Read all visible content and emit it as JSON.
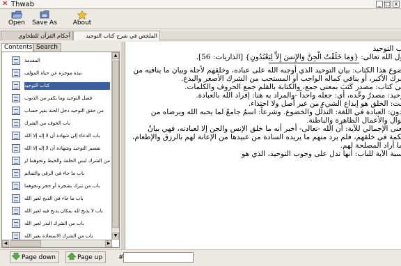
{
  "window": {
    "title": "Thwab",
    "controls": [
      "_",
      "□",
      "x"
    ]
  },
  "toolbar": {
    "open_label": "Open",
    "saveas_label": "Save As",
    "about_label": "About"
  },
  "top_tabs": [
    {
      "label": "أحكام القرآن للطحاوي"
    },
    {
      "label": "الملخص في شرح كتاب التوحيد"
    }
  ],
  "side_tabs": [
    {
      "label": "Contents"
    },
    {
      "label": "Search"
    }
  ],
  "contents": [
    {
      "label": "المقدمة"
    },
    {
      "label": "نبذة موجزة عن حياة المؤلف"
    },
    {
      "label": "كتاب التوحيد"
    },
    {
      "label": "فضل التوحيد وما يكفر من الذنوب"
    },
    {
      "label": "من حقق التوحيد دخل الجنة بغير حساب"
    },
    {
      "label": "باب الخوف من الشرك"
    },
    {
      "label": "باب الدعاء إلى شهادة أن لا إله إلا الله"
    },
    {
      "label": "تفسير التوحيد وشهادة أن لا إله إلا الله"
    },
    {
      "label": "من الشرك لبس الحلقة والخيط ونحوهما لرفع البلاء أو دفعه"
    },
    {
      "label": "باب ما جاء في الرقى والتمائم"
    },
    {
      "label": "باب من تبرك بشجرة أو حجر ونحوهما"
    },
    {
      "label": "باب ما جاء في الذبح لغير الله"
    },
    {
      "label": "باب لا يذبح لله بمكان يذبح فيه لغير الله"
    },
    {
      "label": "باب من الشرك النذر لغير الله"
    },
    {
      "label": "باب من الشرك الاستعاذة بغير الله"
    },
    {
      "label": "باب من الشرك أن يستغيث بغير الله أو يدعو غيره"
    },
    {
      "label": "باب قول الله تعالى: أيشركون ما لا يخلق شيئا وهم يخلقون ولا يستطيعون لهم نصرا ولا أنفسهم ينصرون"
    }
  ],
  "article": {
    "lines": [
      "كتاب التوحيد",
      "وقول الله تعالى: {وَمَا خَلَقْتُ الْجِنَّ وَالإِنسَ إِلاَّ لِيَعْبُدُونِ} [الذاريات: 56]."
    ],
    "paragraphs": [
      "موضوع هذا الكتاب: بيان التوحيد الذي أوجبه الله على عباده، وخلقهم لأجله وبيان ما ينافيه من الشرك الأكبر، أو ينافي كماله الواجب أو المستحب من الشرك الأصغر والبدع.",
      "معنى كتاب: مصدر كَتَبَ بمعنى جمع، والكتابة بالقلم جمع الحروف والكلمات.",
      "التوحيد: مصدرُ وحَّده، أي: جعله واحداً -والمراد به هنا: إفراد الله بالعبادة.",
      "خلقت: الخلق هو إبداع الشيء من غير أصل ولا احتذاء.",
      "يعبدون: العبادة في اللغة: التذلُّل والخضوع. وشرعاً: اسمٌ جامعٌ لما يحبه الله ويرضاه من الأقوال والأعمال الظاهرة والباطنة.",
      "المعنى الإجمالي للآية: أن الله -تعالى- أخبر أنه ما خلق الإنس والجن إلا لعبادته، فهي بيانٌ للحكمة في خلقهم، فلم يرد منهم ما يريده السادة من عبيدها من الإعانة لهم بالرزق والإطعام، وإنما أراد المصلحة لهم.",
      "مناسبة الآية للباب: أنها تدل على وجوب التوحيد، الذي هو"
    ]
  },
  "bottombar": {
    "page_down_label": "Page down",
    "page_up_label": "Page up",
    "hash_label": "#:",
    "page_value": ""
  },
  "colors": {
    "selection": "#3c5fa0",
    "window_bg": "#ece9e2"
  }
}
